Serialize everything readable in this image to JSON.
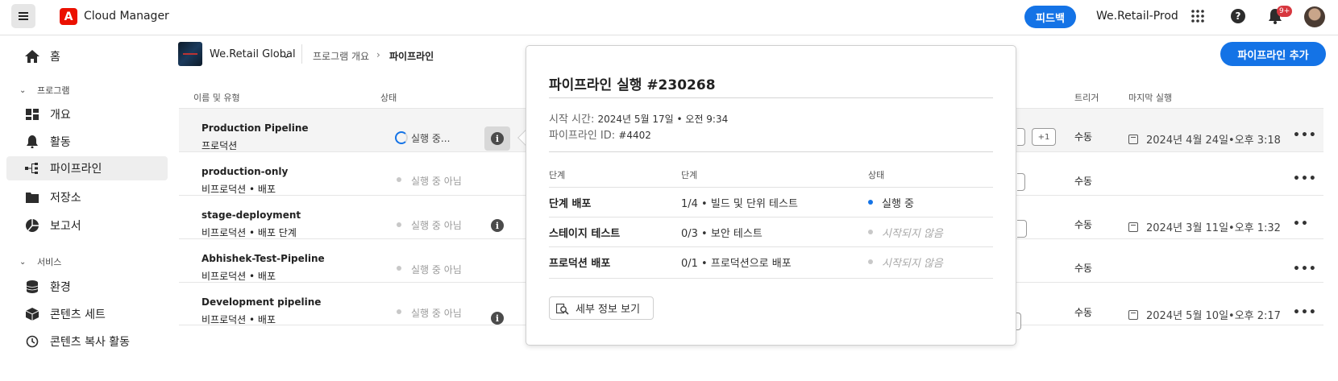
{
  "header": {
    "app_title": "Cloud Manager",
    "feedback_label": "피드백",
    "org_name": "We.Retail-Prod",
    "notification_badge": "9+"
  },
  "sidebar": {
    "items": [
      {
        "label": "홈",
        "icon": "home-icon"
      },
      {
        "label": "개요",
        "icon": "dashboard-icon"
      },
      {
        "label": "활동",
        "icon": "bell-icon"
      },
      {
        "label": "파이프라인",
        "icon": "pipeline-icon",
        "active": true
      },
      {
        "label": "저장소",
        "icon": "folder-icon"
      },
      {
        "label": "보고서",
        "icon": "chart-icon"
      },
      {
        "label": "환경",
        "icon": "database-icon"
      },
      {
        "label": "콘텐츠 세트",
        "icon": "box-icon"
      },
      {
        "label": "콘텐츠 복사 활동",
        "icon": "history-icon"
      }
    ],
    "sections": {
      "program": "프로그램",
      "services": "서비스"
    }
  },
  "breadcrumb": {
    "program_name": "We.Retail Global",
    "overview": "프로그램 개요",
    "current": "파이프라인"
  },
  "add_pipeline_label": "파이프라인 추가",
  "table": {
    "columns": {
      "name": "이름 및 유형",
      "status": "상태",
      "trigger": "트리거",
      "last_run": "마지막 실행"
    },
    "rows": [
      {
        "name": "Production Pipeline",
        "type": "프로덕션",
        "status": "실행 중...",
        "running": true,
        "trigger": "수동",
        "last_run": "2024년 4월 24일•오후 3:18",
        "chip": "+1"
      },
      {
        "name": "production-only",
        "type": "비프로덕션 • 배포",
        "status": "실행 중 아님",
        "trigger": "수동",
        "last_run": ""
      },
      {
        "name": "stage-deployment",
        "type": "비프로덕션 • 배포 단계",
        "status": "실행 중 아님",
        "trigger": "수동",
        "last_run": "2024년 3월 11일•오후 1:32"
      },
      {
        "name": "Abhishek-Test-Pipeline",
        "type": "비프로덕션 • 배포",
        "status": "실행 중 아님",
        "trigger": "수동",
        "last_run": ""
      },
      {
        "name": "Development pipeline",
        "type": "비프로덕션 • 배포",
        "status": "실행 중 아님",
        "trigger": "수동",
        "last_run": "2024년 5월 10일•오후 2:17"
      }
    ]
  },
  "popover": {
    "title": "파이프라인 실행 #230268",
    "start_label": "시작 시간:",
    "start_value": "2024년 5월 17일 • 오전 9:34",
    "pipeline_id_label": "파이프라인 ID:",
    "pipeline_id_value": "#4402",
    "columns": {
      "stage": "단계",
      "step": "단계",
      "status": "상태"
    },
    "rows": [
      {
        "stage": "단계 배포",
        "step": "1/4 • 빌드 및 단위 테스트",
        "status": "실행 중",
        "running": true
      },
      {
        "stage": "스테이지 테스트",
        "step": "0/3 • 보안 테스트",
        "status": "시작되지 않음"
      },
      {
        "stage": "프로덕션 배포",
        "step": "0/1 • 프로덕션으로 배포",
        "status": "시작되지 않음"
      }
    ],
    "details_label": "세부 정보 보기"
  },
  "colors": {
    "accent": "#1473e6",
    "running_dot": "#1473e6",
    "idle_dot": "#c8c8c8"
  }
}
